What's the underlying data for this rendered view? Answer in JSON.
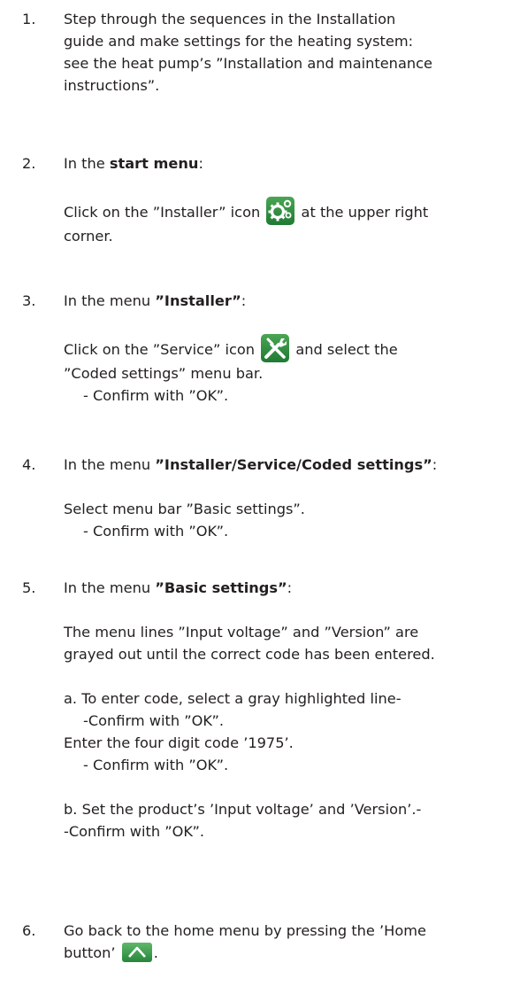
{
  "steps": [
    {
      "num": "1.",
      "lines": [
        "Step through the sequences in the Installation",
        "guide and make settings for the heating system:",
        "see the heat pump’s ”Installation and maintenance",
        "instructions”."
      ]
    },
    {
      "num": "2.",
      "intro": "In the ",
      "intro_bold": "start menu",
      "intro_end": ":",
      "l1_a": "Click on the ”Installer” icon ",
      "l1_b": " at the upper right",
      "l2": "corner.",
      "icon": "gears-icon"
    },
    {
      "num": "3.",
      "intro": "In the menu ",
      "intro_bold": "”Installer”",
      "intro_end": ":",
      "l1_a": "Click on the ”Service” icon ",
      "l1_b": " and select the",
      "l2": "”Coded settings” menu bar.",
      "l3": "- Confirm with ”OK”.",
      "icon": "wrench-screwdriver-icon"
    },
    {
      "num": "4.",
      "intro": "In the menu ",
      "intro_bold": "”Installer/Service/Coded settings”",
      "intro_end": ":",
      "l1": "Select menu bar ”Basic settings”.",
      "l2": "- Confirm with ”OK”."
    },
    {
      "num": "5.",
      "intro": "In the menu ",
      "intro_bold": "”Basic settings”",
      "intro_end": ":",
      "p1": "The menu lines ”Input voltage” and ”Version” are",
      "p2": "grayed out until the correct code has been entered.",
      "a1": "a. To enter code, select a gray highlighted line-",
      "a2": "-Confirm with ”OK”.",
      "a3": "Enter the four digit code ’1975’.",
      "a4": "- Confirm with ”OK”.",
      "b1": "b. Set the product’s ’Input voltage’ and ’Version’.-",
      "b2": "-Confirm with ”OK”."
    },
    {
      "num": "6.",
      "l1": "Go back to the home menu by pressing the ’Home",
      "l2_a": "button’ ",
      "l2_b": ".",
      "icon": "home-icon"
    }
  ]
}
